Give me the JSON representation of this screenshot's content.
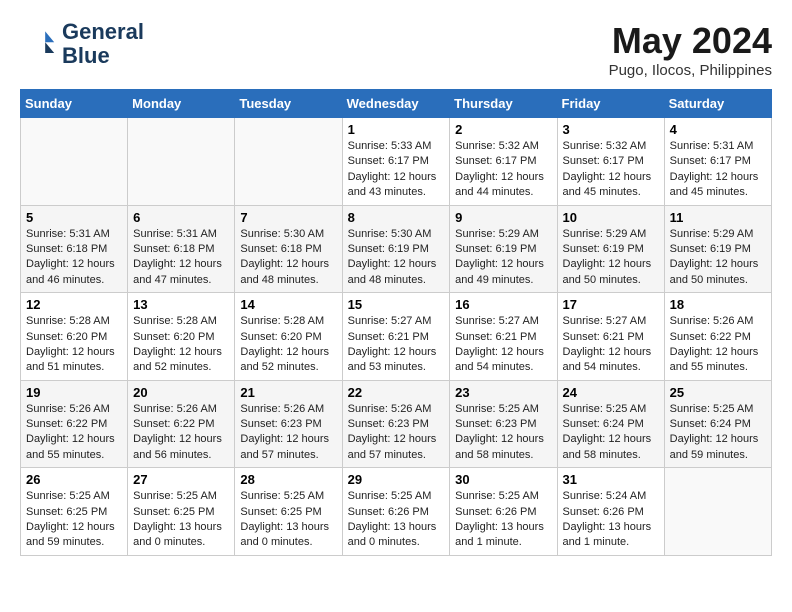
{
  "header": {
    "logo_line1": "General",
    "logo_line2": "Blue",
    "title": "May 2024",
    "subtitle": "Pugo, Ilocos, Philippines"
  },
  "weekdays": [
    "Sunday",
    "Monday",
    "Tuesday",
    "Wednesday",
    "Thursday",
    "Friday",
    "Saturday"
  ],
  "weeks": [
    [
      {
        "day": "",
        "info": ""
      },
      {
        "day": "",
        "info": ""
      },
      {
        "day": "",
        "info": ""
      },
      {
        "day": "1",
        "info": "Sunrise: 5:33 AM\nSunset: 6:17 PM\nDaylight: 12 hours\nand 43 minutes."
      },
      {
        "day": "2",
        "info": "Sunrise: 5:32 AM\nSunset: 6:17 PM\nDaylight: 12 hours\nand 44 minutes."
      },
      {
        "day": "3",
        "info": "Sunrise: 5:32 AM\nSunset: 6:17 PM\nDaylight: 12 hours\nand 45 minutes."
      },
      {
        "day": "4",
        "info": "Sunrise: 5:31 AM\nSunset: 6:17 PM\nDaylight: 12 hours\nand 45 minutes."
      }
    ],
    [
      {
        "day": "5",
        "info": "Sunrise: 5:31 AM\nSunset: 6:18 PM\nDaylight: 12 hours\nand 46 minutes."
      },
      {
        "day": "6",
        "info": "Sunrise: 5:31 AM\nSunset: 6:18 PM\nDaylight: 12 hours\nand 47 minutes."
      },
      {
        "day": "7",
        "info": "Sunrise: 5:30 AM\nSunset: 6:18 PM\nDaylight: 12 hours\nand 48 minutes."
      },
      {
        "day": "8",
        "info": "Sunrise: 5:30 AM\nSunset: 6:19 PM\nDaylight: 12 hours\nand 48 minutes."
      },
      {
        "day": "9",
        "info": "Sunrise: 5:29 AM\nSunset: 6:19 PM\nDaylight: 12 hours\nand 49 minutes."
      },
      {
        "day": "10",
        "info": "Sunrise: 5:29 AM\nSunset: 6:19 PM\nDaylight: 12 hours\nand 50 minutes."
      },
      {
        "day": "11",
        "info": "Sunrise: 5:29 AM\nSunset: 6:19 PM\nDaylight: 12 hours\nand 50 minutes."
      }
    ],
    [
      {
        "day": "12",
        "info": "Sunrise: 5:28 AM\nSunset: 6:20 PM\nDaylight: 12 hours\nand 51 minutes."
      },
      {
        "day": "13",
        "info": "Sunrise: 5:28 AM\nSunset: 6:20 PM\nDaylight: 12 hours\nand 52 minutes."
      },
      {
        "day": "14",
        "info": "Sunrise: 5:28 AM\nSunset: 6:20 PM\nDaylight: 12 hours\nand 52 minutes."
      },
      {
        "day": "15",
        "info": "Sunrise: 5:27 AM\nSunset: 6:21 PM\nDaylight: 12 hours\nand 53 minutes."
      },
      {
        "day": "16",
        "info": "Sunrise: 5:27 AM\nSunset: 6:21 PM\nDaylight: 12 hours\nand 54 minutes."
      },
      {
        "day": "17",
        "info": "Sunrise: 5:27 AM\nSunset: 6:21 PM\nDaylight: 12 hours\nand 54 minutes."
      },
      {
        "day": "18",
        "info": "Sunrise: 5:26 AM\nSunset: 6:22 PM\nDaylight: 12 hours\nand 55 minutes."
      }
    ],
    [
      {
        "day": "19",
        "info": "Sunrise: 5:26 AM\nSunset: 6:22 PM\nDaylight: 12 hours\nand 55 minutes."
      },
      {
        "day": "20",
        "info": "Sunrise: 5:26 AM\nSunset: 6:22 PM\nDaylight: 12 hours\nand 56 minutes."
      },
      {
        "day": "21",
        "info": "Sunrise: 5:26 AM\nSunset: 6:23 PM\nDaylight: 12 hours\nand 57 minutes."
      },
      {
        "day": "22",
        "info": "Sunrise: 5:26 AM\nSunset: 6:23 PM\nDaylight: 12 hours\nand 57 minutes."
      },
      {
        "day": "23",
        "info": "Sunrise: 5:25 AM\nSunset: 6:23 PM\nDaylight: 12 hours\nand 58 minutes."
      },
      {
        "day": "24",
        "info": "Sunrise: 5:25 AM\nSunset: 6:24 PM\nDaylight: 12 hours\nand 58 minutes."
      },
      {
        "day": "25",
        "info": "Sunrise: 5:25 AM\nSunset: 6:24 PM\nDaylight: 12 hours\nand 59 minutes."
      }
    ],
    [
      {
        "day": "26",
        "info": "Sunrise: 5:25 AM\nSunset: 6:25 PM\nDaylight: 12 hours\nand 59 minutes."
      },
      {
        "day": "27",
        "info": "Sunrise: 5:25 AM\nSunset: 6:25 PM\nDaylight: 13 hours\nand 0 minutes."
      },
      {
        "day": "28",
        "info": "Sunrise: 5:25 AM\nSunset: 6:25 PM\nDaylight: 13 hours\nand 0 minutes."
      },
      {
        "day": "29",
        "info": "Sunrise: 5:25 AM\nSunset: 6:26 PM\nDaylight: 13 hours\nand 0 minutes."
      },
      {
        "day": "30",
        "info": "Sunrise: 5:25 AM\nSunset: 6:26 PM\nDaylight: 13 hours\nand 1 minute."
      },
      {
        "day": "31",
        "info": "Sunrise: 5:24 AM\nSunset: 6:26 PM\nDaylight: 13 hours\nand 1 minute."
      },
      {
        "day": "",
        "info": ""
      }
    ]
  ]
}
